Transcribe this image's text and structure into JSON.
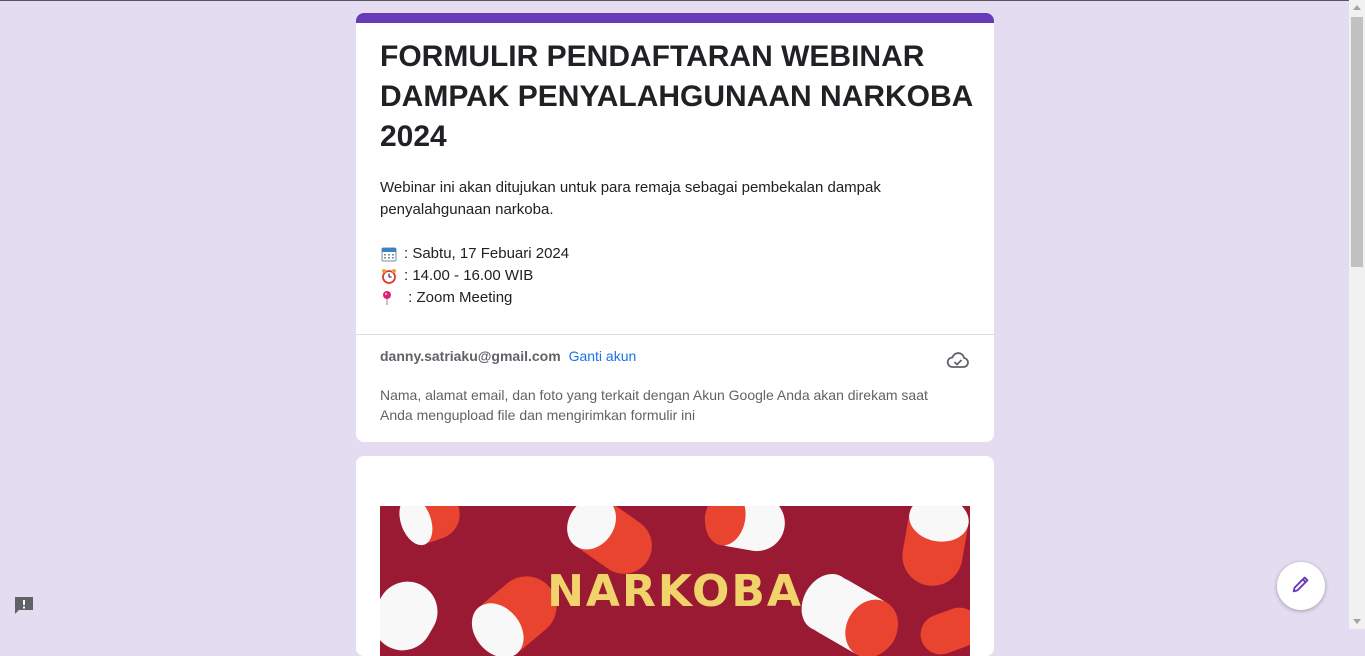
{
  "form": {
    "title": "FORMULIR PENDAFTARAN WEBINAR DAMPAK PENYALAHGUNAAN NARKOBA 2024",
    "description": "Webinar ini akan ditujukan untuk para remaja sebagai pembekalan dampak penyalahgunaan narkoba.",
    "details": [
      {
        "icon": "calendar-icon",
        "text": ": Sabtu, 17 Febuari 2024"
      },
      {
        "icon": "alarm-clock-icon",
        "text": ": 14.00 - 16.00 WIB"
      },
      {
        "icon": "location-pin-icon",
        "text": " : Zoom Meeting"
      }
    ]
  },
  "account": {
    "email": "danny.satriaku@gmail.com",
    "switch_label": "Ganti akun",
    "privacy_note": "Nama, alamat email, dan foto yang terkait dengan Akun Google Anda akan direkam saat Anda mengupload file dan mengirimkan formulir ini"
  },
  "banner": {
    "text": "NARKOBA"
  },
  "colors": {
    "accent": "#673ab7",
    "background": "#e4dcf0",
    "link": "#1a73e8",
    "banner_bg": "#9b1a33",
    "banner_text": "#f0d36a"
  },
  "icons": {
    "cloud": "cloud-saved-icon",
    "feedback": "feedback-icon",
    "edit": "edit-pencil-icon"
  }
}
